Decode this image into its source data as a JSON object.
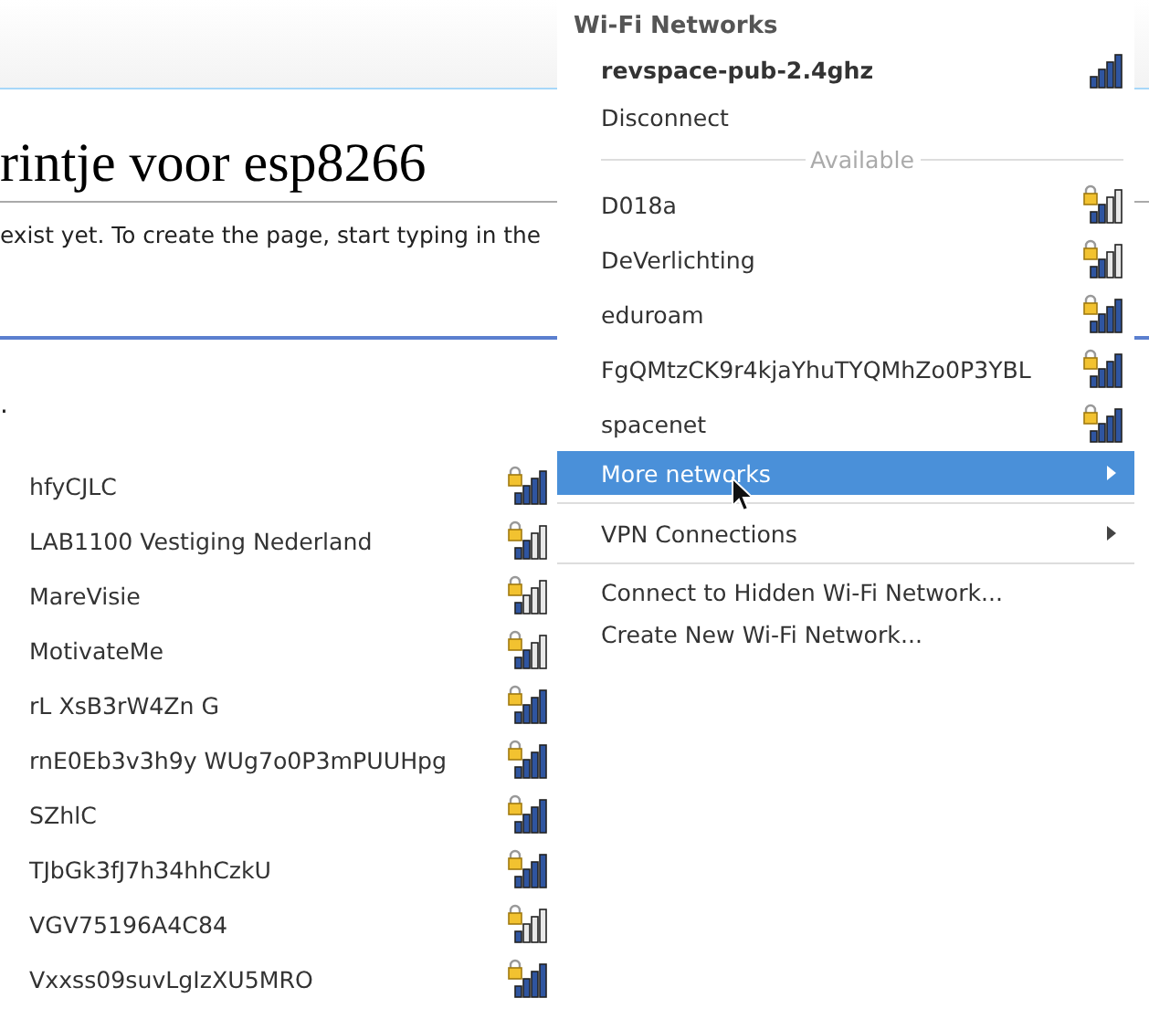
{
  "page": {
    "title": "rintje voor esp8266",
    "notice": "exist yet. To create the page, start typing in the",
    "fragment": "."
  },
  "menu": {
    "title": "Wi-Fi Networks",
    "active_network": {
      "name": "revspace-pub-2.4ghz",
      "secured": false,
      "kind": "full"
    },
    "disconnect": "Disconnect",
    "section_label": "Available",
    "networks": [
      {
        "name": "D018a",
        "secured": true,
        "kind": "half"
      },
      {
        "name": "DeVerlichting",
        "secured": true,
        "kind": "half"
      },
      {
        "name": "eduroam",
        "secured": true,
        "kind": "full"
      },
      {
        "name": "FgQMtzCK9r4kjaYhuTYQMhZo0P3YBL",
        "secured": true,
        "kind": "full"
      },
      {
        "name": "spacenet",
        "secured": true,
        "kind": "full"
      }
    ],
    "items": [
      {
        "label": "More networks",
        "selected": true
      },
      {
        "label": "VPN Connections",
        "selected": false
      }
    ],
    "actions": [
      "Connect to Hidden Wi-Fi Network...",
      "Create New Wi-Fi Network..."
    ]
  },
  "submenu": {
    "networks": [
      {
        "name": "hfyCJLC",
        "secured": true,
        "kind": "full"
      },
      {
        "name": "LAB1100 Vestiging Nederland",
        "secured": true,
        "kind": "half"
      },
      {
        "name": "MareVisie",
        "secured": true,
        "kind": "low"
      },
      {
        "name": "MotivateMe",
        "secured": true,
        "kind": "half"
      },
      {
        "name": "rL XsB3rW4Zn G",
        "secured": true,
        "kind": "full"
      },
      {
        "name": "rnE0Eb3v3h9y WUg7o0P3mPUUHpg",
        "secured": true,
        "kind": "full"
      },
      {
        "name": "SZhlC",
        "secured": true,
        "kind": "full"
      },
      {
        "name": "TJbGk3fJ7h34hhCzkU",
        "secured": true,
        "kind": "full"
      },
      {
        "name": "VGV75196A4C84",
        "secured": true,
        "kind": "low"
      },
      {
        "name": "Vxxss09suvLgIzXU5MRO",
        "secured": true,
        "kind": "full"
      }
    ]
  }
}
